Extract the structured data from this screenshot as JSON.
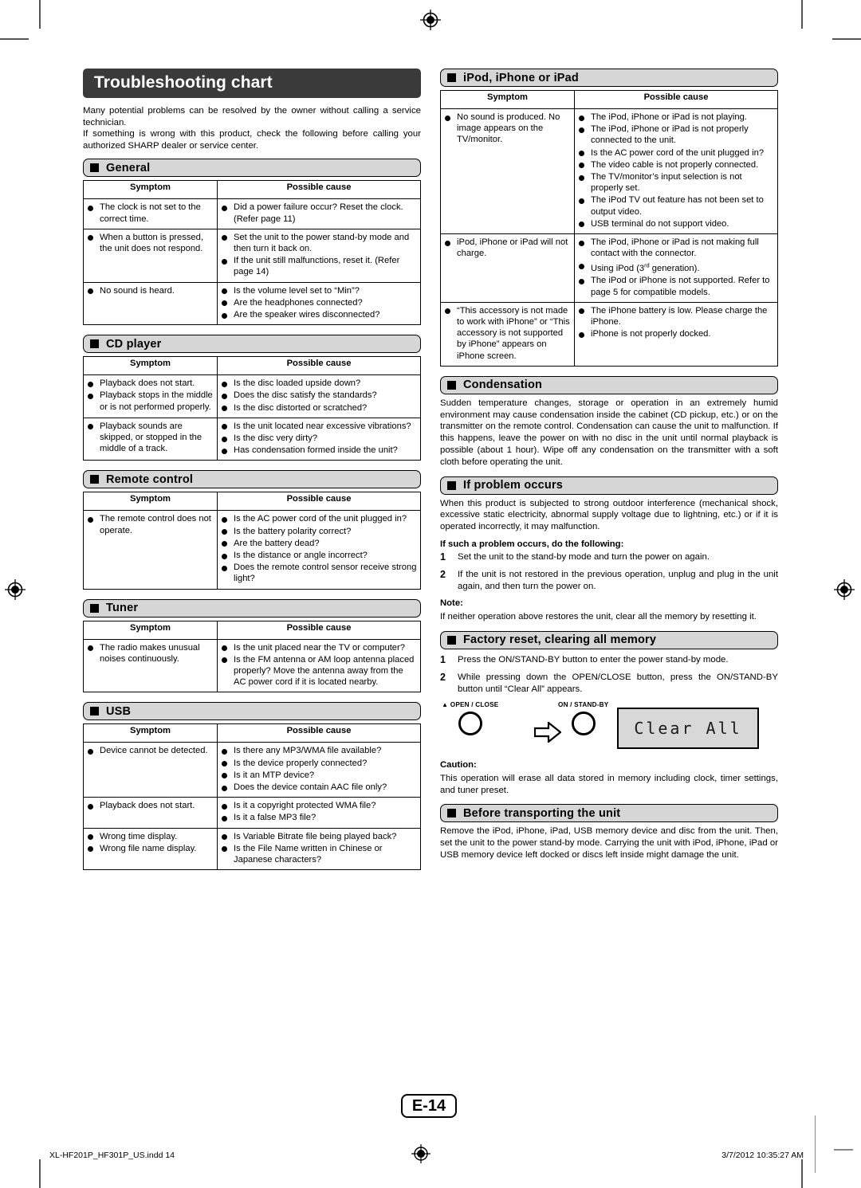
{
  "document": {
    "title": "Troubleshooting chart",
    "page_label": "E-14",
    "accent_dark": "#3a3a3a",
    "section_header_bg": "#d6d6d6"
  },
  "intro": {
    "para1": "Many potential problems can be resolved by the owner without calling a service technician.",
    "para2": "If something is wrong with this product, check the following before calling your authorized SHARP dealer or service center."
  },
  "table_headers": {
    "symptom": "Symptom",
    "possible_cause": "Possible cause"
  },
  "sections": {
    "general": {
      "title": "General",
      "rows": [
        {
          "symptom": [
            "The clock is not set to the correct time."
          ],
          "cause": [
            "Did a power failure occur? Reset the clock. (Refer page 11)"
          ]
        },
        {
          "symptom": [
            "When a button is pressed, the unit does not respond."
          ],
          "cause": [
            "Set the unit to the power stand-by mode and then turn it back on.",
            "If the unit still malfunctions, reset it. (Refer page 14)"
          ]
        },
        {
          "symptom": [
            "No sound is heard."
          ],
          "cause": [
            "Is the volume level set to “Min”?",
            "Are the headphones connected?",
            "Are the speaker wires disconnected?"
          ]
        }
      ]
    },
    "cd_player": {
      "title": "CD player",
      "rows": [
        {
          "symptom": [
            "Playback does not start.",
            "Playback stops in the middle or is not performed properly."
          ],
          "cause": [
            "Is the disc loaded upside down?",
            "Does the disc satisfy the standards?",
            "Is the disc distorted or scratched?"
          ]
        },
        {
          "symptom": [
            "Playback sounds are skipped, or stopped in the middle of a track."
          ],
          "cause": [
            "Is the unit located near excessive vibrations?",
            "Is the disc very dirty?",
            "Has condensation formed inside the unit?"
          ]
        }
      ]
    },
    "remote_control": {
      "title": "Remote control",
      "rows": [
        {
          "symptom": [
            "The remote control does not operate."
          ],
          "cause": [
            "Is the AC power cord of the unit plugged in?",
            "Is the battery polarity correct?",
            "Are the battery dead?",
            "Is the distance or angle incorrect?",
            "Does the remote control sensor receive strong light?"
          ]
        }
      ]
    },
    "tuner": {
      "title": "Tuner",
      "rows": [
        {
          "symptom": [
            "The radio makes unusual noises continuously."
          ],
          "cause": [
            "Is the unit placed near the TV or computer?",
            "Is the FM antenna or AM loop antenna placed properly? Move the antenna away from the AC power cord if it is located nearby."
          ]
        }
      ]
    },
    "usb": {
      "title": "USB",
      "rows": [
        {
          "symptom": [
            "Device cannot be detected."
          ],
          "cause": [
            "Is there any MP3/WMA file available?",
            "Is the device properly connected?",
            "Is it an MTP device?",
            "Does the device contain AAC file only?"
          ]
        },
        {
          "symptom": [
            "Playback does not start."
          ],
          "cause": [
            "Is it a copyright protected WMA file?",
            "Is it a false MP3 file?"
          ]
        },
        {
          "symptom": [
            "Wrong time display.",
            "Wrong file name display."
          ],
          "cause": [
            "Is Variable Bitrate file being played back?",
            "Is the File Name written in Chinese or Japanese characters?"
          ]
        }
      ]
    },
    "ipod": {
      "title": "iPod, iPhone or iPad",
      "rows": [
        {
          "symptom": [
            "No sound is produced. No image appears on the TV/monitor."
          ],
          "cause": [
            "The iPod, iPhone or iPad is not playing.",
            "The iPod, iPhone or iPad is not properly connected to the unit.",
            "Is the AC power cord of the unit plugged in?",
            "The video cable is not properly connected.",
            "The TV/monitor’s input selection is not properly set.",
            "The iPod TV out feature has not been set to output video.",
            "USB terminal do not support video."
          ]
        },
        {
          "symptom": [
            "iPod, iPhone or iPad will not charge."
          ],
          "cause": [
            "The iPod, iPhone or iPad is not making full contact with the connector.",
            "Using iPod (3rd generation).",
            "The iPod or iPhone is not supported. Refer to page 5 for compatible models."
          ]
        },
        {
          "symptom": [
            "“This accessory is not made to work with iPhone” or “This accessory is not supported by iPhone” appears on iPhone screen."
          ],
          "cause": [
            "The iPhone battery is low. Please charge the iPhone.",
            "iPhone is not properly docked."
          ]
        }
      ]
    },
    "condensation": {
      "title": "Condensation",
      "body": "Sudden temperature changes, storage or operation in an extremely humid environment may cause condensation inside the cabinet (CD pickup, etc.) or on the transmitter on the remote control. Condensation can cause the unit to malfunction. If this happens, leave the power on with no disc in the unit until normal playback is possible (about 1 hour). Wipe off any condensation on the transmitter with a soft cloth before operating the unit."
    },
    "if_problem_occurs": {
      "title": "If problem occurs",
      "body": "When this product is subjected to strong outdoor interference (mechanical shock, excessive static electricity, abnormal supply voltage due to lightning, etc.) or if it is operated incorrectly, it may malfunction.",
      "lead": "If such a problem occurs, do the following:",
      "steps": [
        {
          "num": "1",
          "text": "Set the unit to the stand-by mode and turn the power on again."
        },
        {
          "num": "2",
          "text": "If the unit is not restored in the previous operation, unplug and plug in the unit again, and then turn the power on."
        }
      ],
      "note_label": "Note:",
      "note_text": "If neither operation above restores the unit, clear all the memory by resetting it."
    },
    "factory_reset": {
      "title": "Factory reset, clearing all memory",
      "steps": [
        {
          "num": "1",
          "text": "Press the ON/STAND-BY button to enter the power stand-by mode."
        },
        {
          "num": "2",
          "text": "While pressing down the OPEN/CLOSE button, press the ON/STAND-BY button until “Clear All” appears."
        }
      ],
      "diagram": {
        "button1_label": "OPEN / CLOSE",
        "button2_label": "ON / STAND-BY",
        "lcd_text": "Clear All"
      },
      "caution_label": "Caution:",
      "caution_text": "This operation will erase all data stored in memory including clock, timer settings, and tuner preset."
    },
    "before_transporting": {
      "title": "Before transporting the unit",
      "body": "Remove the iPod, iPhone, iPad, USB memory device and disc from the unit. Then, set the unit to the power stand-by mode. Carrying the unit with iPod, iPhone, iPad or USB memory device left docked or discs left inside might damage the unit."
    }
  },
  "footer": {
    "file_name": "XL-HF201P_HF301P_US.indd   14",
    "timestamp": "3/7/2012   10:35:27 AM"
  }
}
